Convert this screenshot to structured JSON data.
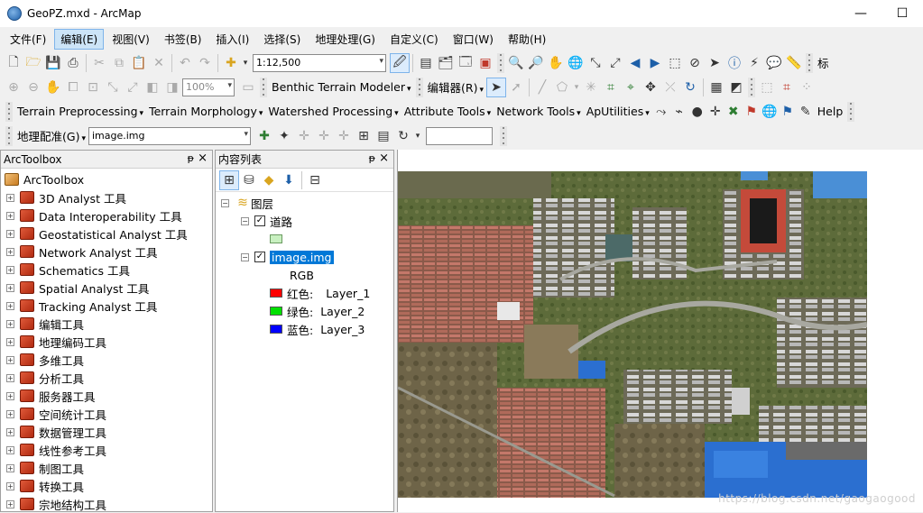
{
  "window": {
    "title": "GeoPZ.mxd - ArcMap",
    "minimize_glyph": "—",
    "maximize_glyph": "☐"
  },
  "menu": [
    "文件(F)",
    "编辑(E)",
    "视图(V)",
    "书签(B)",
    "插入(I)",
    "选择(S)",
    "地理处理(G)",
    "自定义(C)",
    "窗口(W)",
    "帮助(H)"
  ],
  "menu_active_index": 1,
  "toolbar1": {
    "scale_value": "1:12,500",
    "cut_label": "标"
  },
  "toolbar2": {
    "zoom_value": "100%",
    "benthic_label": "Benthic Terrain Modeler",
    "editor_label": "编辑器(R)"
  },
  "toolbar3": {
    "menus": [
      "Terrain Preprocessing",
      "Terrain Morphology",
      "Watershed Processing",
      "Attribute Tools",
      "Network Tools",
      "ApUtilities"
    ],
    "help_label": "Help"
  },
  "toolbar4": {
    "georef_label": "地理配准(G)",
    "layer_value": "image.img",
    "text_value": ""
  },
  "arctoolbox": {
    "header": "ArcToolbox",
    "pin_glyph": "ᵽ",
    "close_glyph": "×",
    "root": "ArcToolbox",
    "items": [
      "3D Analyst 工具",
      "Data Interoperability 工具",
      "Geostatistical Analyst 工具",
      "Network Analyst 工具",
      "Schematics 工具",
      "Spatial Analyst 工具",
      "Tracking Analyst 工具",
      "编辑工具",
      "地理编码工具",
      "多维工具",
      "分析工具",
      "服务器工具",
      "空间统计工具",
      "数据管理工具",
      "线性参考工具",
      "制图工具",
      "转换工具",
      "宗地结构工具"
    ]
  },
  "toc": {
    "header": "内容列表",
    "pin_glyph": "ᵽ",
    "close_glyph": "×",
    "root": "图层",
    "layer1": "道路",
    "layer2": "image.img",
    "rgb_label": "RGB",
    "bands": [
      {
        "channel": "红色:",
        "band": "Layer_1",
        "color": "#ff0000"
      },
      {
        "channel": "绿色:",
        "band": "Layer_2",
        "color": "#00e000"
      },
      {
        "channel": "蓝色:",
        "band": "Layer_3",
        "color": "#0000ff"
      }
    ],
    "road_symbol_color": "#c8f0c0"
  },
  "watermark": "https://blog.csdn.net/gaogaogood",
  "colors": {
    "menu_active": "#cce4f7",
    "selected_layer": "#0078d7"
  }
}
